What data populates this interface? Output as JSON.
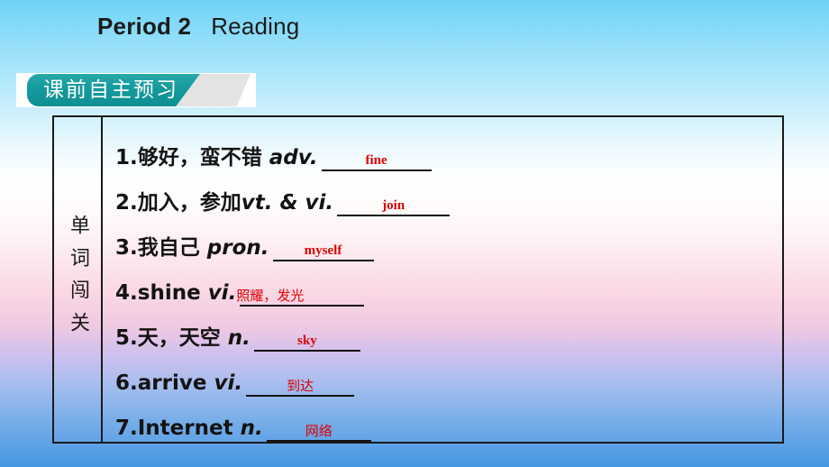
{
  "slide": {
    "title_bold": "Period 2",
    "title_light": "Reading",
    "background": {
      "top_color": "#6FD3F7",
      "mid_color": "#FFFFFF",
      "pink_color": "#FAD9E4",
      "bottom_color": "#4697E3"
    }
  },
  "banner": {
    "label": "课前自主预习",
    "teal_color": "#169C9E",
    "gray_color": "#E3E3E3"
  },
  "content": {
    "side_label": "单词闯关",
    "answer_color": "#E00000",
    "items": [
      {
        "number": "1.",
        "prompt": "够好，蛮不错 ",
        "pos": "adv.",
        "answer": "fine",
        "answer_lang": "en",
        "blank_width": 122
      },
      {
        "number": "2.",
        "prompt": "加入，参加",
        "pos": "vt. & vi.",
        "answer": "join",
        "answer_lang": "en",
        "blank_width": 125
      },
      {
        "number": "3.",
        "prompt": "我自己 ",
        "pos": "pron.",
        "answer": "myself",
        "answer_lang": "en",
        "blank_width": 112
      },
      {
        "number": "4.",
        "prompt": "shine ",
        "pos": "vi.",
        "answer": "照耀，发光",
        "answer_lang": "cn",
        "blank_width": 138
      },
      {
        "number": "5.",
        "prompt": "天，天空 ",
        "pos": "n.",
        "answer": "sky",
        "answer_lang": "en",
        "blank_width": 118
      },
      {
        "number": "6.",
        "prompt": "arrive ",
        "pos": "vi.",
        "answer": "到达",
        "answer_lang": "cn",
        "blank_width": 120
      },
      {
        "number": "7.",
        "prompt": "Internet ",
        "pos": "n.",
        "answer": "网络",
        "answer_lang": "cn",
        "blank_width": 116
      }
    ]
  }
}
